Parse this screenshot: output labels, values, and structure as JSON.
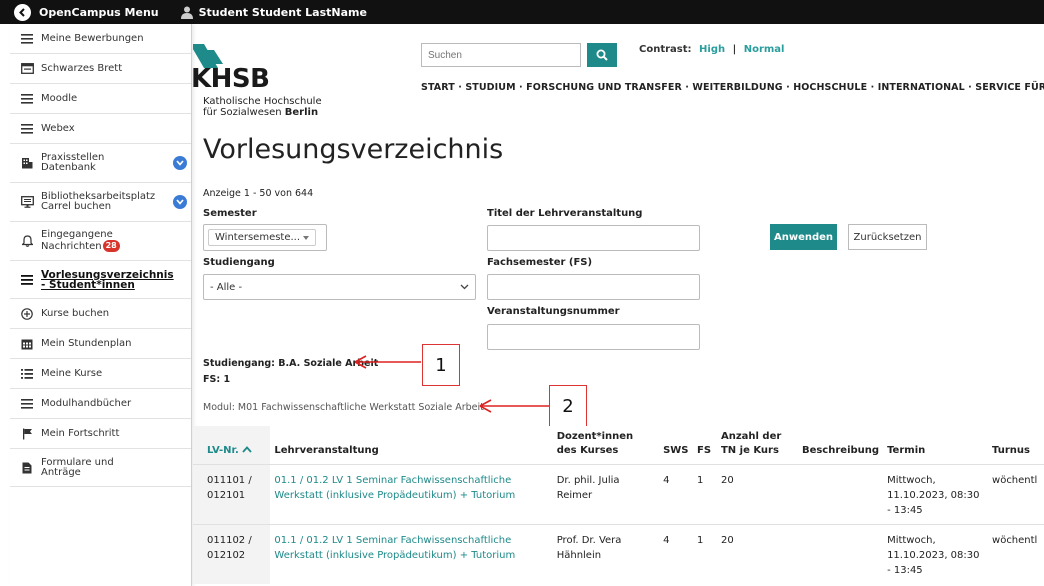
{
  "topbar": {
    "menu_label": "OpenCampus Menu",
    "user_name": "Student Student LastName"
  },
  "sidebar": {
    "items": [
      {
        "label": "Meine Bewerbungen",
        "icon": "menu-icon"
      },
      {
        "label": "Schwarzes Brett",
        "icon": "board-icon"
      },
      {
        "label": "Moodle",
        "icon": "menu-icon"
      },
      {
        "label": "Webex",
        "icon": "menu-icon"
      },
      {
        "label": "Praxisstellen Datenbank",
        "icon": "building-icon",
        "expandable": true
      },
      {
        "label": "Bibliotheksarbeitsplatz Carrel buchen",
        "icon": "monitor-icon",
        "expandable": true
      },
      {
        "label": "Eingegangene Nachrichten",
        "icon": "bell-icon",
        "badge": "28"
      },
      {
        "label": "Vorlesungsverzeichnis - Student*innen",
        "icon": "menu-icon",
        "active": true
      },
      {
        "label": "Kurse buchen",
        "icon": "plus-circle-icon"
      },
      {
        "label": "Mein Stundenplan",
        "icon": "calendar-icon"
      },
      {
        "label": "Meine Kurse",
        "icon": "list-icon"
      },
      {
        "label": "Modulhandbücher",
        "icon": "menu-icon"
      },
      {
        "label": "Mein Fortschritt",
        "icon": "flag-icon"
      },
      {
        "label": "Formulare und Anträge",
        "icon": "document-icon"
      }
    ]
  },
  "header": {
    "logo_word": "KHSB",
    "logo_line1": "Katholische Hochschule",
    "logo_line2a": "für Sozialwesen ",
    "logo_line2b": "Berlin",
    "search_placeholder": "Suchen",
    "contrast_label": "Contrast:",
    "contrast_high": "High",
    "contrast_sep": "|",
    "contrast_normal": "Normal",
    "nav": "START  · STUDIUM  · FORSCHUNG UND TRANSFER  · WEITERBILDUNG  · HOCHSCHULE  · INTERNATIONAL  · SERVICE FÜR STUDIERENDE"
  },
  "page": {
    "title": "Vorlesungsverzeichnis",
    "count": "Anzeige 1 - 50 von 644"
  },
  "filters": {
    "semester_label": "Semester",
    "semester_value": "Wintersemeste...",
    "titel_label": "Titel der Lehrveranstaltung",
    "apply_label": "Anwenden",
    "reset_label": "Zurücksetzen",
    "studiengang_label": "Studiengang",
    "studiengang_value": "- Alle -",
    "fachsemester_label": "Fachsemester (FS)",
    "nummer_label": "Veranstaltungsnummer"
  },
  "results": {
    "studiengang": "Studiengang: B.A. Soziale Arbeit",
    "fs": "FS: 1",
    "modul": "Modul: M01 Fachwissenschaftliche Werkstatt Soziale Arbeit"
  },
  "callouts": {
    "one": "1",
    "two": "2"
  },
  "table": {
    "headers": {
      "lvnr": "LV-Nr.",
      "lehr": "Lehrveranstaltung",
      "dozent": "Dozent*innen des Kurses",
      "sws": "SWS",
      "fs": "FS",
      "anzahl": "Anzahl der TN je Kurs",
      "beschreibung": "Beschreibung",
      "termin": "Termin",
      "turnus": "Turnus"
    },
    "rows": [
      {
        "lvnr": "011101 / 012101",
        "lehr": "01.1 / 01.2 LV 1 Seminar Fachwissenschaftliche Werkstatt (inklusive Propädeutikum) + Tutorium",
        "dozent": "Dr. phil. Julia Reimer",
        "sws": "4",
        "fs": "1",
        "anzahl": "20",
        "beschreibung": "",
        "termin": "Mittwoch, 11.10.2023, 08:30 - 13:45",
        "turnus": "wöchentl"
      },
      {
        "lvnr": "011102 / 012102",
        "lehr": "01.1 / 01.2 LV 1 Seminar Fachwissenschaftliche Werkstatt (inklusive Propädeutikum) + Tutorium",
        "dozent": "Prof. Dr. Vera Hähnlein",
        "sws": "4",
        "fs": "1",
        "anzahl": "20",
        "beschreibung": "",
        "termin": "Mittwoch, 11.10.2023, 08:30 - 13:45",
        "turnus": "wöchentl"
      }
    ]
  },
  "colors": {
    "teal": "#1f8a8a",
    "link": "#2a9d9d",
    "badge": "#d9342b",
    "chevron": "#3a7bd5",
    "callout": "#dd2222"
  }
}
